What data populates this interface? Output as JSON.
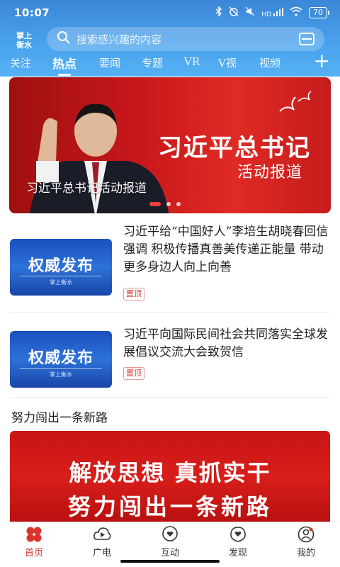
{
  "status_bar": {
    "time": "10:07",
    "signal_text": "HD",
    "battery": "70"
  },
  "header": {
    "logo_line1": "掌上",
    "logo_line2": "衡水",
    "search_placeholder": "搜索感兴趣的内容",
    "tabs": [
      "关注",
      "热点",
      "要闻",
      "专题",
      "VR",
      "V视",
      "视频"
    ],
    "active_tab": "热点",
    "colors": {
      "header_top": "#3b86d8",
      "header_bottom": "#55b1f3"
    }
  },
  "banner": {
    "title_line1": "习近平总书记",
    "title_line2": "活动报道",
    "caption": "习近平总书记活动报道",
    "slide_count": 3,
    "active_slide": 0
  },
  "news": [
    {
      "title": "习近平给“中国好人”李培生胡晓春回信强调 积极传播真善美传递正能量 带动更多身边人向上向善",
      "thumb_main": "权威发布",
      "thumb_sub": "掌上衡水",
      "tag": "置顶"
    },
    {
      "title": "习近平向国际民间社会共同落实全球发展倡议交流大会致贺信",
      "thumb_main": "权威发布",
      "thumb_sub": "掌上衡水",
      "tag": "置顶"
    }
  ],
  "section": {
    "title": "努力闯出一条新路",
    "banner_line1": "解放思想 真抓实干",
    "banner_line2": "努力闯出一条新路"
  },
  "bottom_nav": [
    {
      "label": "首页",
      "icon": "home-clover-icon",
      "active": true
    },
    {
      "label": "广电",
      "icon": "play-cloud-icon",
      "active": false
    },
    {
      "label": "互动",
      "icon": "chat-heart-icon",
      "active": false
    },
    {
      "label": "发现",
      "icon": "discover-heart-icon",
      "active": false
    },
    {
      "label": "我的",
      "icon": "profile-icon",
      "active": false
    }
  ],
  "accent_color": "#d8342c"
}
